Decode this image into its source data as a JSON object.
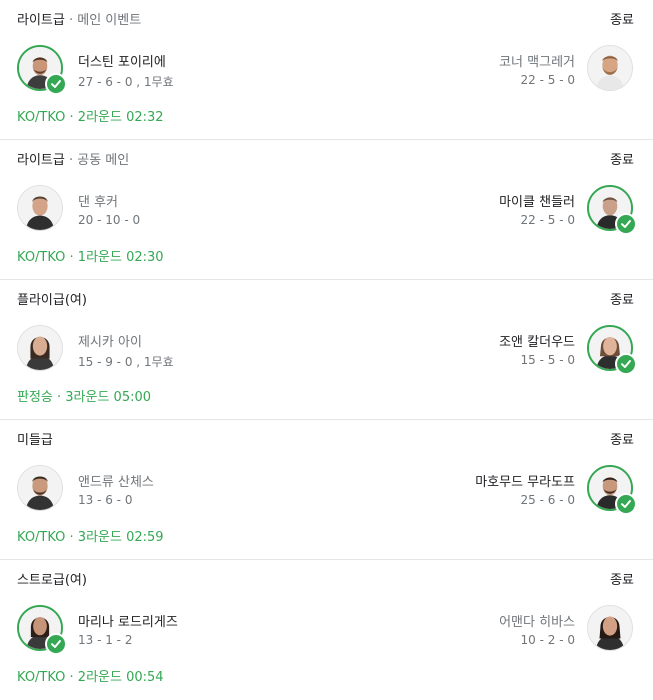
{
  "fights": [
    {
      "weight_class": "라이트급",
      "sub_label": " · 메인 이벤트",
      "status": "종료",
      "left": {
        "name": "더스틴 포이리에",
        "record": "27 - 6 - 0 , 1무효",
        "winner": true
      },
      "right": {
        "name": "코너 맥그레거",
        "record": "22 - 5 - 0",
        "winner": false
      },
      "result": "KO/TKO · 2라운드 02:32"
    },
    {
      "weight_class": "라이트급",
      "sub_label": " · 공동 메인",
      "status": "종료",
      "left": {
        "name": "댄 후커",
        "record": "20 - 10 - 0",
        "winner": false
      },
      "right": {
        "name": "마이클 챈들러",
        "record": "22 - 5 - 0",
        "winner": true
      },
      "result": "KO/TKO · 1라운드 02:30"
    },
    {
      "weight_class": "플라이급(여)",
      "sub_label": "",
      "status": "종료",
      "left": {
        "name": "제시카 아이",
        "record": "15 - 9 - 0 , 1무효",
        "winner": false
      },
      "right": {
        "name": "조앤 칼더우드",
        "record": "15 - 5 - 0",
        "winner": true
      },
      "result": "판정승 · 3라운드 05:00"
    },
    {
      "weight_class": "미들급",
      "sub_label": "",
      "status": "종료",
      "left": {
        "name": "앤드류 산체스",
        "record": "13 - 6 - 0",
        "winner": false
      },
      "right": {
        "name": "마호무드 무라도프",
        "record": "25 - 6 - 0",
        "winner": true
      },
      "result": "KO/TKO · 3라운드 02:59"
    },
    {
      "weight_class": "스트로급(여)",
      "sub_label": "",
      "status": "종료",
      "left": {
        "name": "마리나 로드리게즈",
        "record": "13 - 1 - 2",
        "winner": true
      },
      "right": {
        "name": "어맨다 히바스",
        "record": "10 - 2 - 0",
        "winner": false
      },
      "result": "KO/TKO · 2라운드 00:54"
    }
  ],
  "colors": {
    "winner_ring": "#34a853",
    "result_text": "#34a853",
    "muted_text": "#70757a",
    "divider": "#e6e6e6"
  },
  "icons": {
    "avatar": "fighter-photo-icon",
    "winner_badge": "check-icon"
  }
}
